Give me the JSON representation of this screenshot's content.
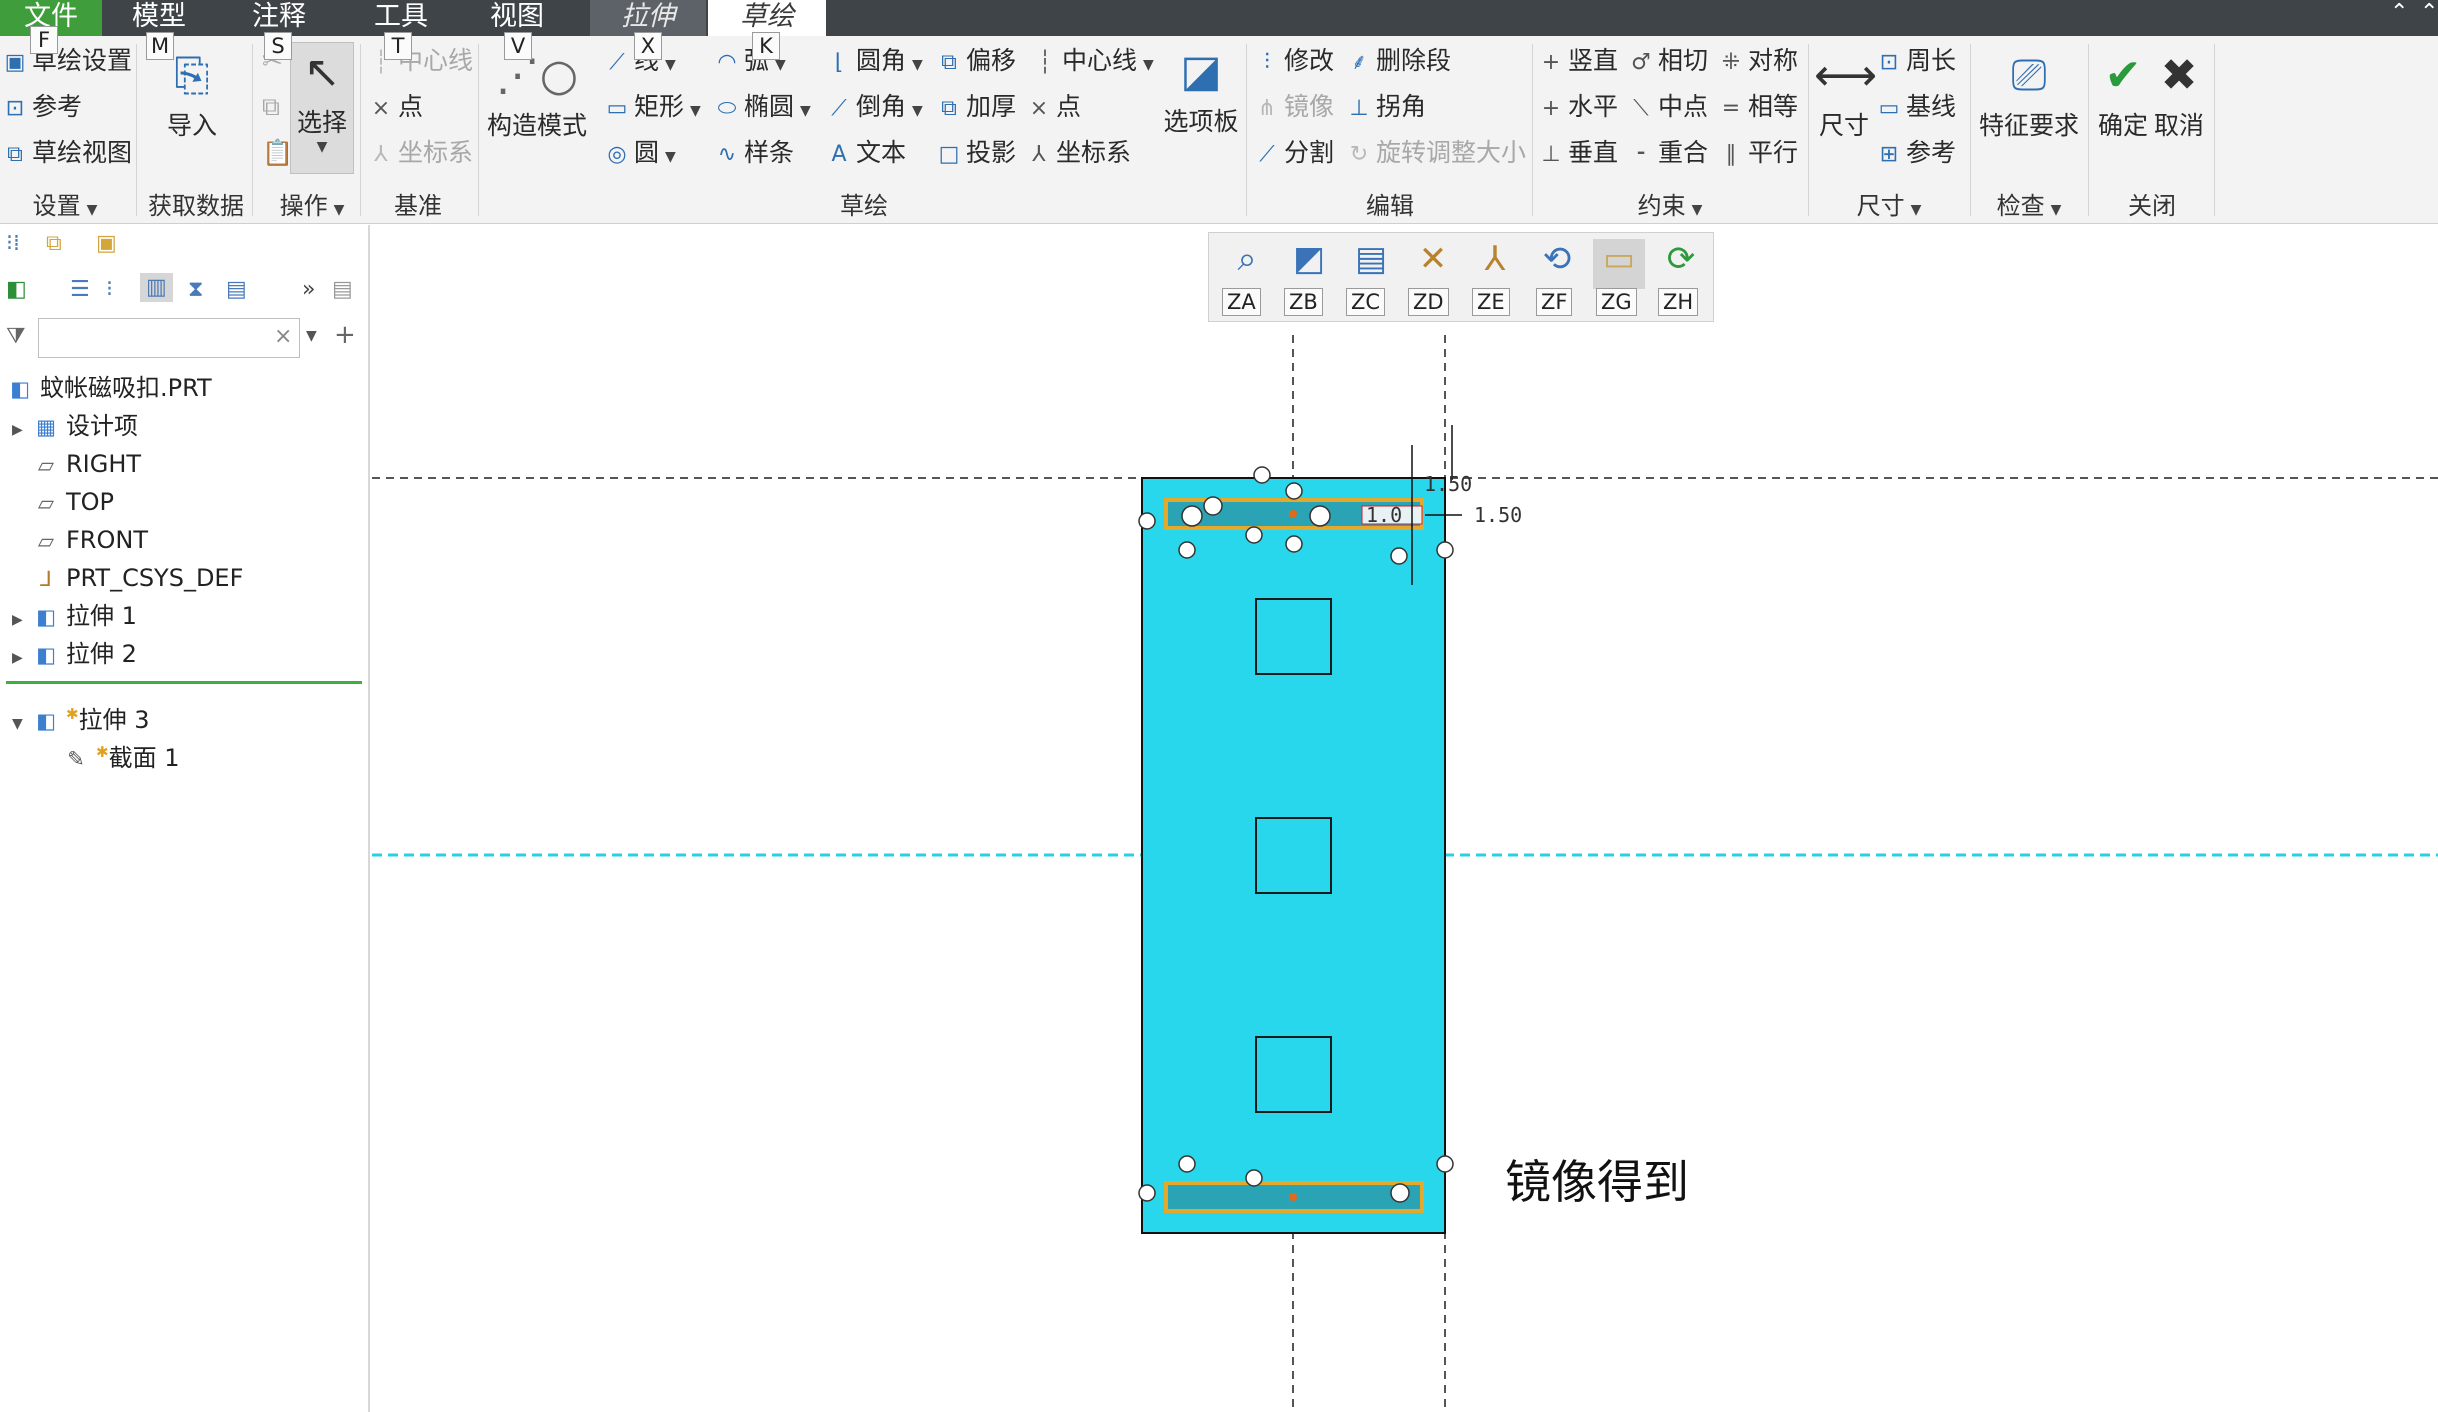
{
  "tabs": {
    "file": "文件",
    "model": "模型",
    "annotate": "注释",
    "tools": "工具",
    "view": "视图",
    "extrude": "拉伸",
    "sketch": "草绘"
  },
  "keytips": {
    "file": "F",
    "model": "M",
    "annotate": "S",
    "tools": "T",
    "view": "V",
    "extrude": "X",
    "sketch": "K"
  },
  "ribbon": {
    "setup": {
      "sketch_setup": "草绘设置",
      "references": "参考",
      "sketch_view": "草绘视图",
      "group": "设置"
    },
    "get_data": {
      "import": "导入",
      "group": "获取数据"
    },
    "operations": {
      "select": "选择",
      "group": "操作"
    },
    "datum": {
      "centerline": "中心线",
      "point": "点",
      "csys": "坐标系",
      "group": "基准"
    },
    "construction_mode": "构造模式",
    "sketching": {
      "line": "线",
      "arc": "弧",
      "fillet": "圆角",
      "offset": "偏移",
      "centerline": "中心线",
      "rectangle": "矩形",
      "ellipse": "椭圆",
      "chamfer": "倒角",
      "thicken": "加厚",
      "point": "点",
      "circle": "圆",
      "spline": "样条",
      "text": "文本",
      "project": "投影",
      "csys": "坐标系",
      "palette": "选项板",
      "group": "草绘"
    },
    "editing": {
      "modify": "修改",
      "delete_segment": "删除段",
      "mirror": "镜像",
      "corner": "拐角",
      "divide": "分割",
      "rotate_resize": "旋转调整大小",
      "group": "编辑"
    },
    "constrain": {
      "vertical": "竖直",
      "tangent": "相切",
      "symmetric": "对称",
      "horizontal": "水平",
      "midpoint": "中点",
      "equal": "相等",
      "perpendicular": "垂直",
      "coincident": "重合",
      "parallel": "平行",
      "group": "约束"
    },
    "dimension": {
      "normal": "尺寸",
      "perimeter": "周长",
      "baseline": "基线",
      "reference": "参考",
      "group": "尺寸"
    },
    "inspect": {
      "feature_req": "特征要求",
      "group": "检查"
    },
    "close": {
      "ok": "确定",
      "cancel": "取消",
      "group": "关闭"
    }
  },
  "tree": {
    "root": "蚊帐磁吸扣.PRT",
    "items": [
      "设计项",
      "RIGHT",
      "TOP",
      "FRONT",
      "PRT_CSYS_DEF",
      "拉伸 1",
      "拉伸 2",
      "拉伸 3",
      "截面 1"
    ]
  },
  "graphics_toolbar": [
    "ZA",
    "ZB",
    "ZC",
    "ZD",
    "ZE",
    "ZF",
    "ZG",
    "ZH"
  ],
  "dimensions": [
    "1.50",
    "1.50",
    "1.0"
  ],
  "annotation": "镜像得到",
  "colors": {
    "part_fill": "#29d7ec",
    "slot_fill": "#2aa4b4",
    "slot_outline": "#e3a92e",
    "file_tab": "#3f9e3b"
  }
}
